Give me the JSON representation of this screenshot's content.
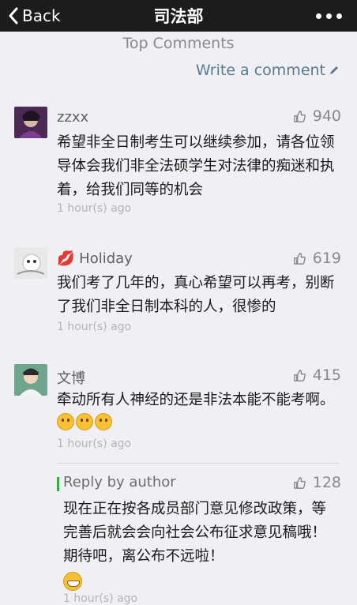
{
  "nav": {
    "back_label": "Back",
    "title": "司法部"
  },
  "section_title": "Top Comments",
  "write_comment_label": "Write a comment",
  "comments": [
    {
      "nickname": "zzxx",
      "likes": "940",
      "text": "希望非全日制考生可以继续参加，请各位领导体会我们非全法硕学生对法律的痴迷和执着，给我们同等的机会",
      "time": "1 hour(s) ago"
    },
    {
      "nickname": "Holiday",
      "nickname_prefix": "💋",
      "likes": "619",
      "text": "我们考了几年的，真心希望可以再考，别断了我们非全日制本科的人，很惨的",
      "time": "1 hour(s) ago"
    },
    {
      "nickname": "文博",
      "likes": "415",
      "text": "牵动所有人神经的还是非法本能不能考啊。",
      "emoji_count": 3,
      "time": "1 hour(s) ago"
    }
  ],
  "reply": {
    "label": "Reply by author",
    "likes": "128",
    "text": "现在正在按各成员部门意见修改政策，等完善后就会会向社会公布征求意见稿哦！期待吧，离公布不远啦！",
    "time": "1 hour(s) ago"
  },
  "colors": {
    "navbar": "#1c1c1e",
    "background": "#efeff4",
    "link": "#5b7a8e",
    "reply_accent": "#37a844"
  }
}
